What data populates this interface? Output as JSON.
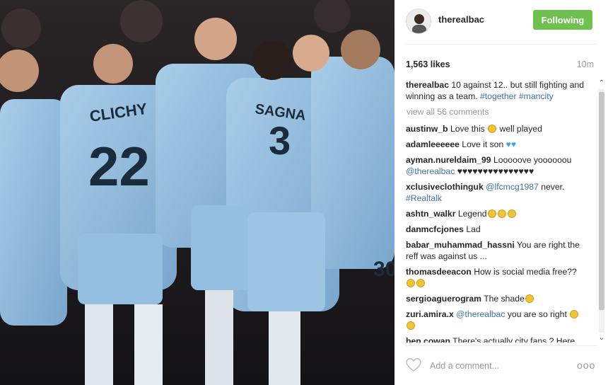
{
  "post": {
    "username": "therealbac",
    "follow_label": "Following",
    "likes": "1,563 likes",
    "time": "10m",
    "caption": {
      "user": "therealbac",
      "text": "10 against 12.. but still fighting and winning as a team.",
      "hashtags": "#together #mancity"
    },
    "view_all": "view all 56 comments",
    "add_comment_placeholder": "Add a comment...",
    "more_label": "ooo"
  },
  "comments": [
    {
      "user": "austinw_b",
      "text": "Love this",
      "text2": "well played"
    },
    {
      "user": "adamleeeeee",
      "text": "Love it son"
    },
    {
      "user": "ayman.nureldaim_99",
      "text": "Looooove yoooooou",
      "mention": "@therealbac",
      "text2": "♥♥♥♥♥♥♥♥♥♥♥♥♥♥♥"
    },
    {
      "user": "xclusiveclothinguk",
      "mention": "@lfcmcg1987",
      "text": "never.",
      "hashtag": "#Realtalk"
    },
    {
      "user": "ashtn_walkr",
      "text": "Legend"
    },
    {
      "user": "danmcfcjones",
      "text": "Lad"
    },
    {
      "user": "babar_muhammad_hassni",
      "text": "You are right the reff was against us ..."
    },
    {
      "user": "thomasdeeacon",
      "text": "How is social media free??"
    },
    {
      "user": "sergioaguerogram",
      "text": "The shade"
    },
    {
      "user": "zuri.amira.x",
      "mention": "@therealbac",
      "text": "you are so right"
    },
    {
      "user": "ben.cowan",
      "text": "There's actually city fans ? Here"
    }
  ],
  "icons": {
    "heart": "heart-outline-icon",
    "avatar": "user-avatar",
    "more": "more-options-icon"
  },
  "colors": {
    "follow_button": "#70c050",
    "link": "#3f729b",
    "kit": "#8fb9dc"
  }
}
